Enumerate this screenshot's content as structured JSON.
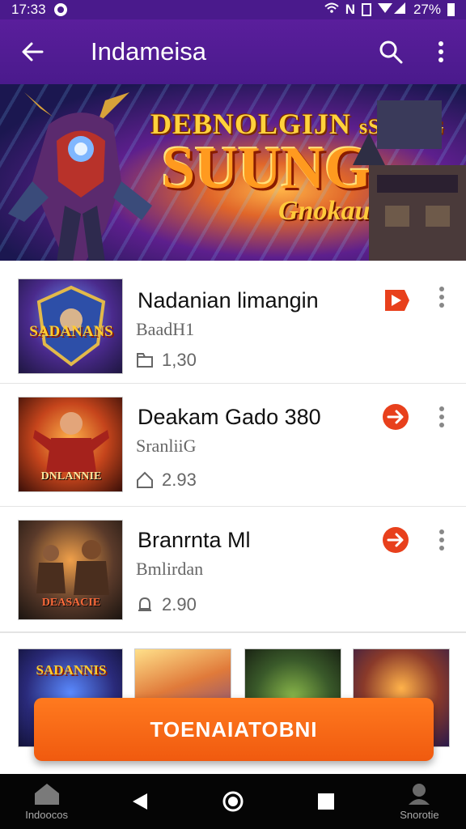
{
  "status_bar": {
    "time": "17:33",
    "battery": "27%"
  },
  "app_bar": {
    "title": "Indameisa",
    "back_icon": "arrow-back-icon",
    "search_icon": "search-icon",
    "menu_icon": "more-vert-icon"
  },
  "banner": {
    "line1": "DEBNOLGIJN",
    "line1b": "sSUULG",
    "line2": "SUUNG",
    "line3": "Gnokau!"
  },
  "items": [
    {
      "name": "Nadanian limangin",
      "subtitle": "BaadH1",
      "stat": "1,30",
      "stat_icon": "folder-icon"
    },
    {
      "name": "Deakam Gado 380",
      "subtitle": "SranliiG",
      "stat": "2.93",
      "stat_icon": "home-icon"
    },
    {
      "name": "Branrnta Ml",
      "subtitle": "Bmlirdan",
      "stat": "2.90",
      "stat_icon": "bell-icon"
    }
  ],
  "thumb_labels": [
    "SADANANS",
    "DNLANNIE",
    "DEASACIE"
  ],
  "grid_labels": [
    "SADANNIS"
  ],
  "cta": {
    "label": "TOENAIATOBNI"
  },
  "nav": {
    "home_label": "Indoocos",
    "profile_label": "Snorotie"
  },
  "colors": {
    "appbar": "#4a1a8c",
    "accent": "#f05a0f",
    "play": "#e8401c"
  }
}
